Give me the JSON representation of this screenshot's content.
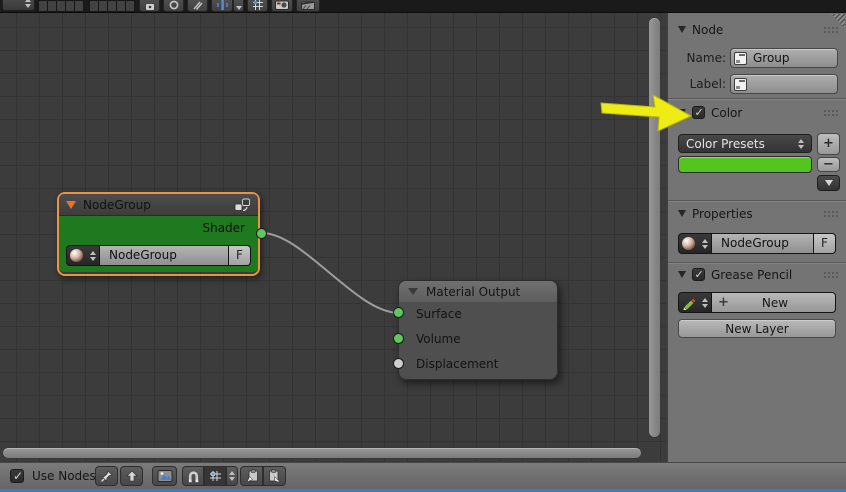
{
  "header": {
    "icons": [
      "mode-dropdown",
      "layer-grid-left",
      "layer-grid-right",
      "lock-icon",
      "proportional-edit-icon",
      "rotation-manipulator-icon",
      "snap-element-icon",
      "snap-dropdown-icon",
      "snap-grid-icon",
      "render-camera-icon",
      "render-animation-icon"
    ]
  },
  "canvas": {
    "wire_color": "#9d9d9d",
    "node_group": {
      "title": "NodeGroup",
      "output_label": "Shader",
      "output_socket_color": "#5fc75f",
      "datablock_value": "NodeGroup",
      "fake_user_label": "F",
      "body_color": "#1f7a1f",
      "selection_border_color": "#ea9340"
    },
    "material_output": {
      "title": "Material Output",
      "inputs": [
        {
          "label": "Surface",
          "socket_color": "#5fc75f"
        },
        {
          "label": "Volume",
          "socket_color": "#5fc75f"
        },
        {
          "label": "Displacement",
          "socket_color": "#cfcfcf"
        }
      ]
    }
  },
  "sidebar": {
    "node_panel": {
      "title": "Node",
      "name_label": "Name:",
      "name_value": "Group",
      "label_label": "Label:",
      "label_value": ""
    },
    "color_panel": {
      "title": "Color",
      "checked": true,
      "presets_label": "Color Presets",
      "swatch_color": "#55c41f",
      "add_label": "+",
      "remove_label": "−"
    },
    "properties_panel": {
      "title": "Properties",
      "datablock_value": "NodeGroup",
      "fake_user_label": "F"
    },
    "grease_pencil_panel": {
      "title": "Grease Pencil",
      "checked": true,
      "plus_label": "+",
      "new_label": "New",
      "new_layer_label": "New Layer"
    }
  },
  "footer": {
    "use_nodes_label": "Use Nodes",
    "use_nodes_checked": true,
    "icons": [
      "pin-icon",
      "parent-up-icon",
      "backdrop-icon",
      "snap-magnet-icon",
      "snap-grid-icon",
      "copy-icon",
      "paste-icon"
    ]
  },
  "annotation": {
    "arrow_color": "#eded15"
  }
}
